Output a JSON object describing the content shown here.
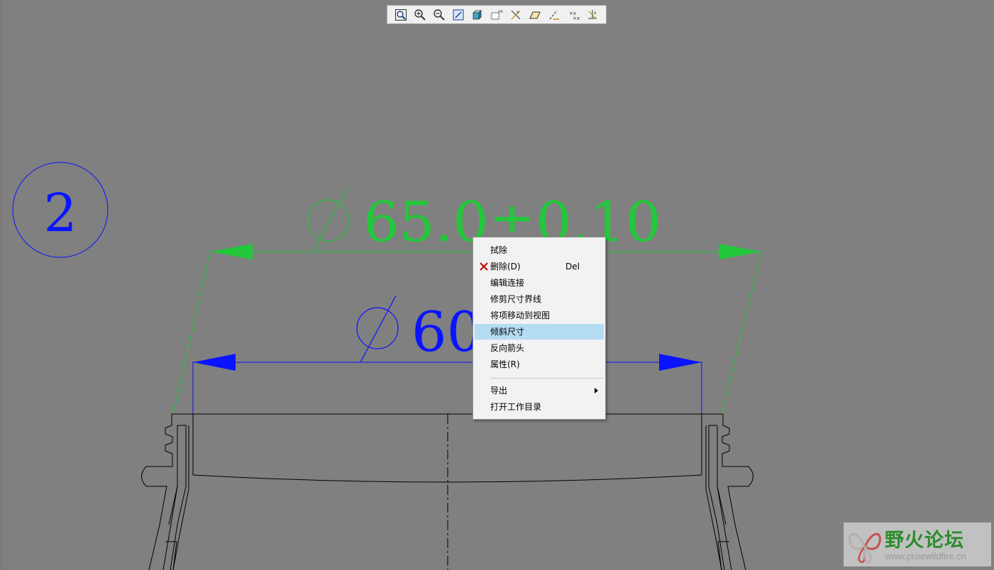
{
  "toolbar": {
    "buttons": [
      {
        "name": "refit-view",
        "icon": "zoom-fit-icon"
      },
      {
        "name": "zoom-in",
        "icon": "zoom-in-icon"
      },
      {
        "name": "zoom-out",
        "icon": "zoom-out-icon"
      },
      {
        "name": "repaint",
        "icon": "repaint-icon"
      },
      {
        "name": "display-style",
        "icon": "display-style-icon"
      },
      {
        "name": "saved-views",
        "icon": "saved-views-icon"
      },
      {
        "name": "datum-display",
        "icon": "datum-display-icon"
      },
      {
        "name": "plane-display",
        "icon": "plane-display-icon"
      },
      {
        "name": "axis-display",
        "icon": "axis-display-icon"
      },
      {
        "name": "point-display",
        "icon": "point-display-icon"
      },
      {
        "name": "csys-display",
        "icon": "csys-display-icon"
      }
    ]
  },
  "drawing": {
    "balloon_label": "2",
    "dim_outer_value": "65.0±0.10",
    "dim_inner_value": "60",
    "colors": {
      "background": "#808080",
      "green": "#22c83a",
      "blue": "#0a14ff",
      "geometry": "#000000"
    }
  },
  "context_menu": {
    "items": [
      {
        "label": "拭除",
        "shortcut": "",
        "icon": ""
      },
      {
        "label": "删除(D)",
        "shortcut": "Del",
        "icon": "delete-x-icon"
      },
      {
        "label": "编辑连接",
        "shortcut": "",
        "icon": ""
      },
      {
        "label": "修剪尺寸界线",
        "shortcut": "",
        "icon": ""
      },
      {
        "label": "将项移动到视图",
        "shortcut": "",
        "icon": ""
      },
      {
        "label": "倾斜尺寸",
        "shortcut": "",
        "icon": "",
        "highlighted": true
      },
      {
        "label": "反向箭头",
        "shortcut": "",
        "icon": ""
      },
      {
        "label": "属性(R)",
        "shortcut": "",
        "icon": ""
      },
      {
        "label": "导出",
        "shortcut": "",
        "icon": "",
        "submenu": true
      },
      {
        "label": "打开工作目录",
        "shortcut": "",
        "icon": ""
      }
    ]
  },
  "watermark": {
    "title": "野火论坛",
    "url": "www.proewildfire.cn"
  }
}
